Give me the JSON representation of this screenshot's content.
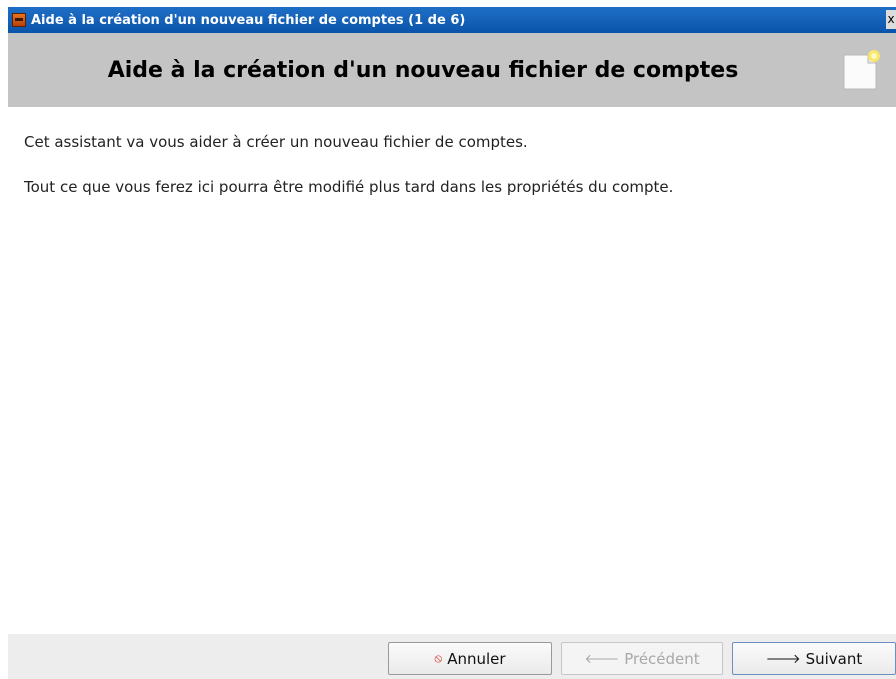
{
  "window": {
    "title": "Aide à la création d'un nouveau fichier de comptes (1 de 6)",
    "close_label": "x"
  },
  "header": {
    "title": "Aide à la création d'un nouveau fichier de comptes",
    "icon": "new-document-icon"
  },
  "content": {
    "line1": "Cet assistant va vous aider à créer un nouveau fichier de comptes.",
    "line2": "Tout ce que vous ferez ici pourra être modifié plus tard dans les propriétés du compte."
  },
  "buttons": {
    "cancel": {
      "label": "Annuler",
      "icon": "stop-icon",
      "enabled": true
    },
    "previous": {
      "label": "Précédent",
      "icon": "arrow-left-icon",
      "enabled": false
    },
    "next": {
      "label": "Suivant",
      "icon": "arrow-right-icon",
      "enabled": true
    }
  },
  "colors": {
    "titlebar": "#0a55aa",
    "header_bg": "#c4c4c4",
    "stop_red": "#d8271c"
  }
}
